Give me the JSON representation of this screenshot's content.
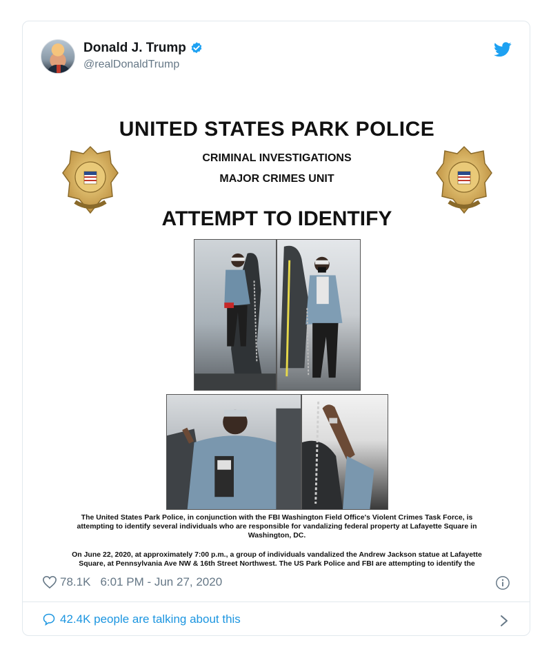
{
  "tweet": {
    "author_name": "Donald J. Trump",
    "handle": "@realDonaldTrump",
    "likes": "78.1K",
    "timestamp": "6:01 PM - Jun 27, 2020",
    "talking": "42.4K people are talking about this"
  },
  "poster": {
    "title": "UNITED STATES PARK POLICE",
    "sub1": "CRIMINAL INVESTIGATIONS",
    "sub2": "MAJOR CRIMES UNIT",
    "attempt": "ATTEMPT TO IDENTIFY",
    "para1": "The United States Park Police, in conjunction with the FBI Washington Field Office's Violent Crimes Task Force, is attempting to identify several individuals who are responsible for vandalizing federal property at Lafayette Square in Washington, DC.",
    "para2": "On June 22, 2020, at approximately 7:00 p.m., a group of individuals vandalized the Andrew Jackson statue at Lafayette Square, at Pennsylvania Ave NW & 16th Street Northwest. The US Park Police and FBI are attempting to identify the"
  },
  "icons": {
    "verified": "verified-badge-icon",
    "brand": "twitter-bird-icon",
    "like": "heart-icon",
    "info": "info-icon",
    "reply": "speech-bubble-icon",
    "more": "chevron-right-icon"
  },
  "colors": {
    "twitter_blue": "#1da1f2",
    "link_blue": "#1b95e0",
    "secondary_text": "#657786",
    "border": "#e1e8ed",
    "badge_gold": "#c9a24a"
  }
}
